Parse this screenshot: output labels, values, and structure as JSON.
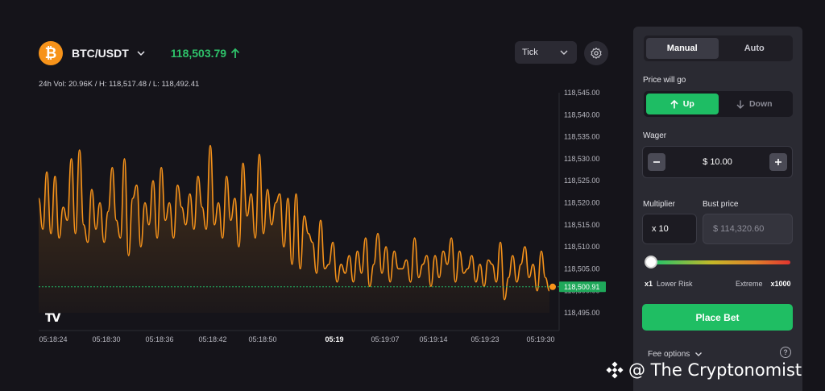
{
  "header": {
    "pair": "BTC/USDT",
    "logo_glyph": "₿",
    "price": "118,503.79",
    "price_color": "#2ec26a",
    "stats": "24h Vol: 20.96K / H: 118,517.48 / L: 118,492.41"
  },
  "toolbar": {
    "interval": "Tick"
  },
  "chart_data": {
    "type": "line",
    "ylim": [
      118495,
      118545
    ],
    "yticks": [
      "118,545.00",
      "118,540.00",
      "118,535.00",
      "118,530.00",
      "118,525.00",
      "118,520.00",
      "118,515.00",
      "118,510.00",
      "118,505.00",
      "118,500.00",
      "118,495.00"
    ],
    "xticks": [
      "05:18:24",
      "05:18:30",
      "05:18:36",
      "05:18:42",
      "05:18:50",
      "05:19",
      "05:19:07",
      "05:19:14",
      "05:19:23",
      "05:19:30"
    ],
    "last_price_label": "118,500.91",
    "current_price_line": 118500.9,
    "line_color": "#f7931a",
    "values": [
      118521,
      118514,
      118527,
      118513,
      118526,
      118512,
      118519,
      118516,
      118530,
      118513,
      118532,
      118515,
      118511,
      118523,
      118514,
      118520,
      118511,
      118518,
      118528,
      118516,
      118512,
      118530,
      118508,
      118521,
      118524,
      118510,
      118520,
      118515,
      118525,
      118512,
      118528,
      118516,
      118520,
      118512,
      118524,
      118519,
      118515,
      118522,
      118514,
      118526,
      118519,
      118514,
      118533,
      118515,
      118520,
      118512,
      118526,
      118516,
      118521,
      118510,
      118529,
      118517,
      118522,
      118512,
      118531,
      118513,
      118523,
      118515,
      118520,
      118522,
      118510,
      118521,
      118506,
      118522,
      118505,
      118517,
      118513,
      118511,
      118504,
      118516,
      118505,
      118506,
      118511,
      118502,
      118506,
      118504,
      118508,
      118502,
      118509,
      118504,
      118512,
      118501,
      118506,
      118513,
      118504,
      118510,
      118502,
      118509,
      118505,
      118505,
      118507,
      118502,
      118512,
      118503,
      118506,
      118508,
      118501,
      118508,
      118503,
      118509,
      118506,
      118512,
      118502,
      118509,
      118504,
      118505,
      118508,
      118502,
      118506,
      118501,
      118507,
      118506,
      118502,
      118511,
      118498,
      118503,
      118508,
      118502,
      118506,
      118510,
      118503,
      118506,
      118500,
      118509,
      118503,
      118500
    ]
  },
  "tv_logo": "TV",
  "panel": {
    "tabs": [
      "Manual",
      "Auto"
    ],
    "direction_label": "Price will go",
    "up_label": "Up",
    "down_label": "Down",
    "wager_label": "Wager",
    "wager_value": "$ 10.00",
    "multiplier_label": "Multiplier",
    "multiplier_value": "x 10",
    "bust_label": "Bust price",
    "bust_value": "$ 114,320.60",
    "risk_left_mult": "x1",
    "risk_left_text": "Lower Risk",
    "risk_right_text": "Extreme",
    "risk_right_mult": "x1000",
    "multiplier_level": 0.01,
    "place_bet": "Place Bet",
    "fee_options": "Fee options",
    "help_glyph": "?"
  },
  "watermark": "@ The Cryptonomist"
}
